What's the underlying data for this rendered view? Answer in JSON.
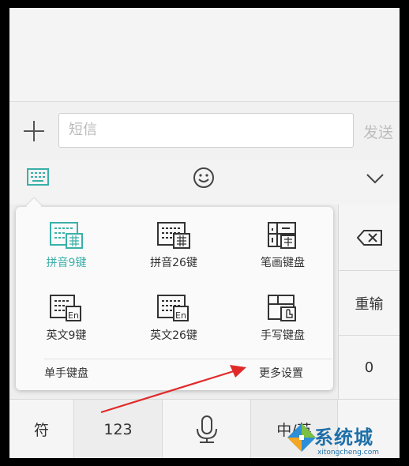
{
  "compose": {
    "input_placeholder": "短信",
    "send_label": "发送"
  },
  "toolbar": {
    "keyboard_icon": "keyboard-icon",
    "emoji_icon": "smiley-icon",
    "collapse_icon": "chevron-down-icon",
    "accent": "#3ab0a8"
  },
  "popup": {
    "items": [
      {
        "label": "拼音9键",
        "icon": "pinyin-9-key-icon",
        "selected": true
      },
      {
        "label": "拼音26键",
        "icon": "pinyin-26-key-icon",
        "selected": false
      },
      {
        "label": "笔画键盘",
        "icon": "stroke-keyboard-icon",
        "selected": false
      },
      {
        "label": "英文9键",
        "icon": "english-9-key-icon",
        "selected": false
      },
      {
        "label": "英文26键",
        "icon": "english-26-key-icon",
        "selected": false
      },
      {
        "label": "手写键盘",
        "icon": "handwriting-keyboard-icon",
        "selected": false
      }
    ],
    "one_hand_label": "单手键盘",
    "more_settings_label": "更多设置"
  },
  "keys": {
    "delete_icon": "backspace-icon",
    "reinput_label": "重输",
    "zero_label": "0",
    "symbol_label": "符",
    "number_label": "123",
    "mic_icon": "microphone-icon",
    "cn_en_label": "中/英"
  },
  "watermark": {
    "text": "系统城",
    "sub": "xitongcheng.com"
  },
  "annotation_color": "#e02a2a"
}
